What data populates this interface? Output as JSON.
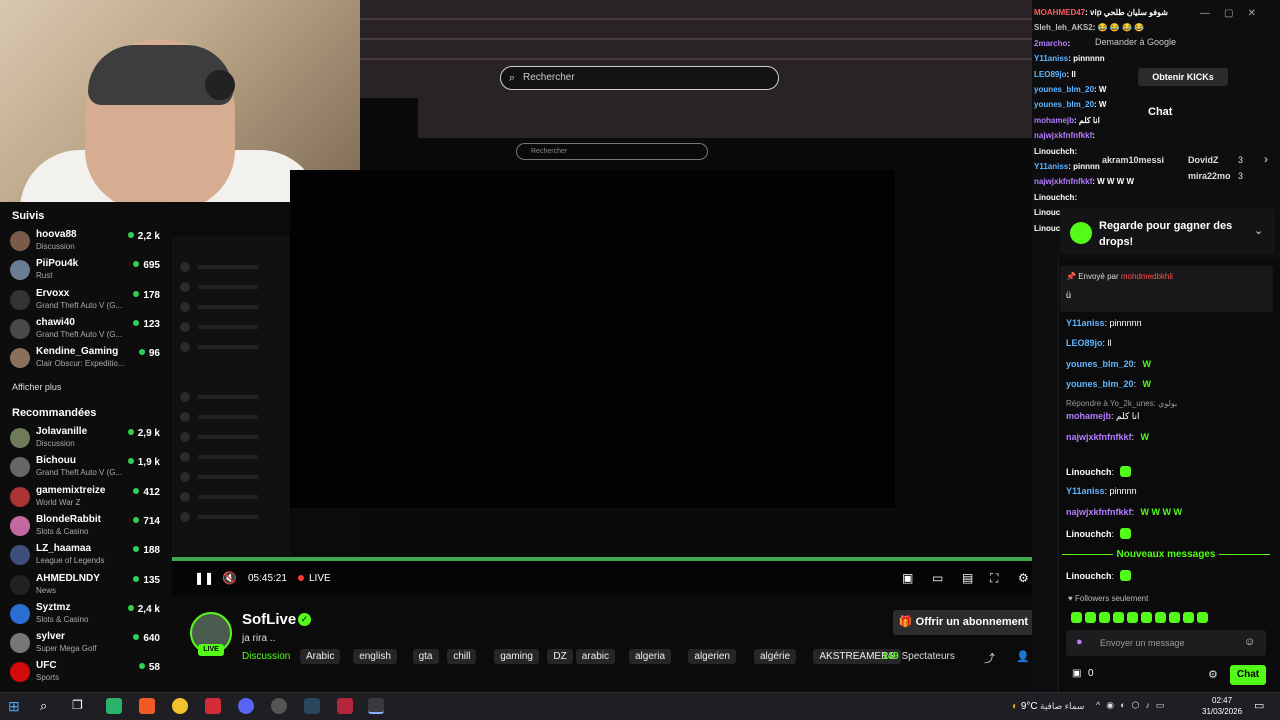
{
  "browser": {
    "search_placeholder": "Rechercher",
    "nested_search": "Rechercher",
    "window_controls": [
      "—",
      "▢",
      "✕"
    ]
  },
  "sidebar": {
    "followed_title": "Suivis",
    "followed": [
      {
        "name": "hoova88",
        "category": "Discussion",
        "viewers": "2,2 k",
        "color": "#7a5a48"
      },
      {
        "name": "PiiPou4k",
        "category": "Rust",
        "viewers": "695",
        "color": "#6a7c92"
      },
      {
        "name": "Ervoxx",
        "category": "Grand Theft Auto V (G...",
        "viewers": "178",
        "color": "#333"
      },
      {
        "name": "chawi40",
        "category": "Grand Theft Auto V (G...",
        "viewers": "123",
        "color": "#4a4a4a"
      },
      {
        "name": "Kendine_Gaming",
        "category": "Clair Obscur: Expeditio...",
        "viewers": "96",
        "color": "#8a6f5a"
      }
    ],
    "show_more": "Afficher plus",
    "recommended_title": "Recommandées",
    "recommended": [
      {
        "name": "Jolavanille",
        "category": "Discussion",
        "viewers": "2,9 k",
        "color": "#6d7b5a"
      },
      {
        "name": "Bichouu",
        "category": "Grand Theft Auto V (G...",
        "viewers": "1,9 k",
        "color": "#666"
      },
      {
        "name": "gamemixtreize",
        "category": "World War Z",
        "viewers": "412",
        "color": "#a33"
      },
      {
        "name": "BlondeRabbit",
        "category": "Slots & Casino",
        "viewers": "714",
        "color": "#c26aa0"
      },
      {
        "name": "LZ_haamaa",
        "category": "League of Legends",
        "viewers": "188",
        "color": "#3d4f7a"
      },
      {
        "name": "AHMEDLNDY",
        "category": "News",
        "viewers": "135",
        "color": "#222"
      },
      {
        "name": "Syztmz",
        "category": "Slots & Casino",
        "viewers": "2,4 k",
        "color": "#2a6ed4"
      },
      {
        "name": "sylver",
        "category": "Super Mega Golf",
        "viewers": "640",
        "color": "#777"
      },
      {
        "name": "UFC",
        "category": "Sports",
        "viewers": "58",
        "color": "#d20a0a"
      }
    ]
  },
  "player": {
    "time": "05:45:21",
    "live": "LIVE"
  },
  "channel": {
    "name": "SofLive",
    "live_badge": "LIVE",
    "title": "ja rira ..",
    "category": "Discussion",
    "tags": [
      "Arabic",
      "english",
      "gta",
      "chill",
      "gaming",
      "DZ",
      "arabic",
      "algeria",
      "algerien",
      "algérie",
      "AKSTREAMERS"
    ],
    "subscribe": "Offrir un abonnement",
    "viewers_count": "149",
    "viewers_label": "Spectateurs"
  },
  "right": {
    "kicks": "Obtenir KICKs",
    "chat_title": "Chat",
    "ask_google": "Demander à Google",
    "leaderboard": [
      "akram10messi",
      "DovidZ",
      "mira22mo"
    ],
    "leaderboard_counts": [
      "3",
      "3"
    ],
    "drops": "Regarde pour gagner des drops!",
    "pinned_by": "Envoyé par",
    "pinned_user": "mohdmedbkhli",
    "pinned_text": "ü",
    "new_messages": "Nouveaux messages",
    "followers_only": "Followers seulement",
    "input_placeholder": "Envoyer un message",
    "send": "Chat",
    "count": "0"
  },
  "mini_chat": [
    {
      "user": "MOAHMED47",
      "msg": "vip شوفو سليان طلحي",
      "color": "#ff5b5b"
    },
    {
      "user": "Sleh_leh_AKS2",
      "msg": "😂 😂 😂 😂",
      "color": "#bfbfbf"
    },
    {
      "user": "2marcho",
      "msg": "",
      "color": "#b57bff"
    },
    {
      "user": "Y11aniss",
      "msg": "pinnnnn",
      "color": "#5fb6ff"
    },
    {
      "user": "LEO89jo",
      "msg": "ll",
      "color": "#5fb6ff"
    },
    {
      "user": "younes_blm_20",
      "msg": "W",
      "color": "#5fb6ff"
    },
    {
      "user": "younes_blm_20",
      "msg": "W",
      "color": "#5fb6ff"
    },
    {
      "user": "mohamejb",
      "msg": "انا كلم",
      "color": "#b57bff"
    },
    {
      "user": "najwjxkfnfnfkkf",
      "msg": "",
      "color": "#b57bff"
    },
    {
      "user": "Linouchch",
      "msg": "",
      "color": "#ffffff"
    },
    {
      "user": "Y11aniss",
      "msg": "pinnnn",
      "color": "#5fb6ff"
    },
    {
      "user": "najwjxkfnfnfkkf",
      "msg": "W W W W",
      "color": "#b57bff"
    },
    {
      "user": "Linouchch",
      "msg": "",
      "color": "#ffffff"
    },
    {
      "user": "Linouchch",
      "msg": "",
      "color": "#ffffff"
    },
    {
      "user": "Linouchch",
      "msg": "",
      "color": "#ffffff"
    }
  ],
  "chat": [
    {
      "user": "Y11aniss",
      "msg": "pinnnnn",
      "color": "#5fb6ff"
    },
    {
      "user": "LEO89jo",
      "msg": "ll",
      "color": "#5fb6ff"
    },
    {
      "user": "younes_blm_20",
      "msg": "W",
      "color": "#5fb6ff"
    },
    {
      "user": "younes_blm_20",
      "msg": "W",
      "color": "#5fb6ff"
    },
    {
      "user": "mohamejb",
      "msg": "انا كلم",
      "color": "#b57bff",
      "reply": "Répondre à Yo_2k_unes: بولوي"
    },
    {
      "user": "najwjxkfnfnfkkf",
      "msg": "W",
      "color": "#b57bff"
    },
    {
      "user": "Linouchch",
      "msg": "",
      "color": "#ffffff"
    },
    {
      "user": "Y11aniss",
      "msg": "pinnnn",
      "color": "#5fb6ff"
    },
    {
      "user": "najwjxkfnfnfkkf",
      "msg": "W W W W",
      "color": "#b57bff"
    },
    {
      "user": "Linouchch",
      "msg": "",
      "color": "#ffffff"
    },
    {
      "user": "Linouchch",
      "msg": "",
      "color": "#ffffff"
    }
  ],
  "taskbar": {
    "temp": "9°C",
    "weather": "سماء صافية",
    "time": "02:47",
    "date": "31/03/2026"
  },
  "colors": {
    "accent": "#53fc18",
    "bg": "#0b0b0c"
  }
}
